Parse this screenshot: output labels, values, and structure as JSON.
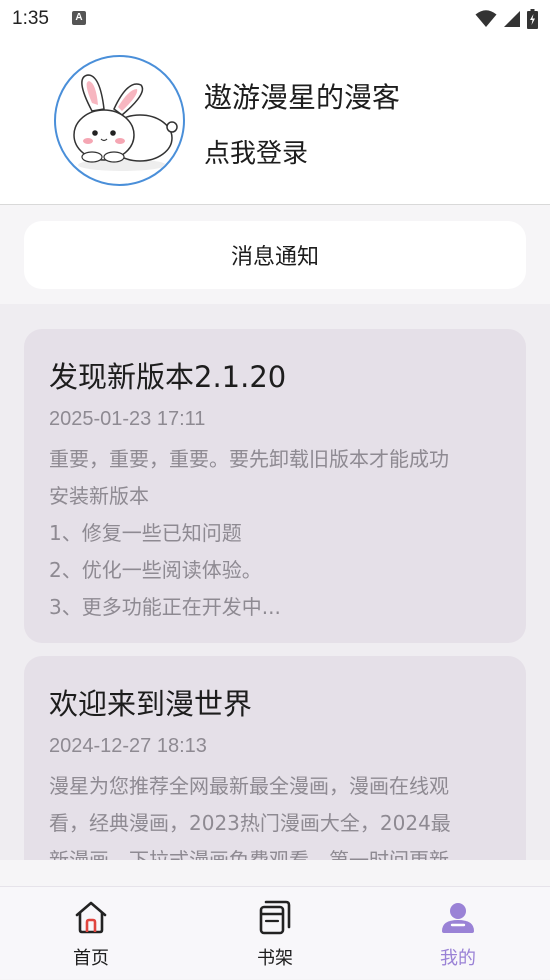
{
  "status_bar": {
    "time": "1:35",
    "notification_glyph": "A"
  },
  "profile": {
    "nickname": "遨游漫星的漫客",
    "login_link": "点我登录"
  },
  "messages": {
    "button_label": "消息通知"
  },
  "feed": {
    "items": [
      {
        "title": "发现新版本2.1.20",
        "date": "2025-01-23 17:11",
        "body": "重要，重要，重要。要先卸载旧版本才能成功\n安装新版本\n1、修复一些已知问题\n2、优化一些阅读体验。\n3、更多功能正在开发中..."
      },
      {
        "title": "欢迎来到漫世界",
        "date": "2024-12-27 18:13",
        "body": "漫星为您推荐全网最新最全漫画，漫画在线观\n看，经典漫画，2023热门漫画大全，2024最\n新漫画，下拉式漫画免费观看。第一时间更新"
      }
    ]
  },
  "tabbar": {
    "tabs": [
      {
        "label": "首页",
        "icon": "home-icon"
      },
      {
        "label": "书架",
        "icon": "bookshelf-icon"
      },
      {
        "label": "我的",
        "icon": "profile-icon"
      }
    ],
    "active_color": "#9a82d6"
  }
}
